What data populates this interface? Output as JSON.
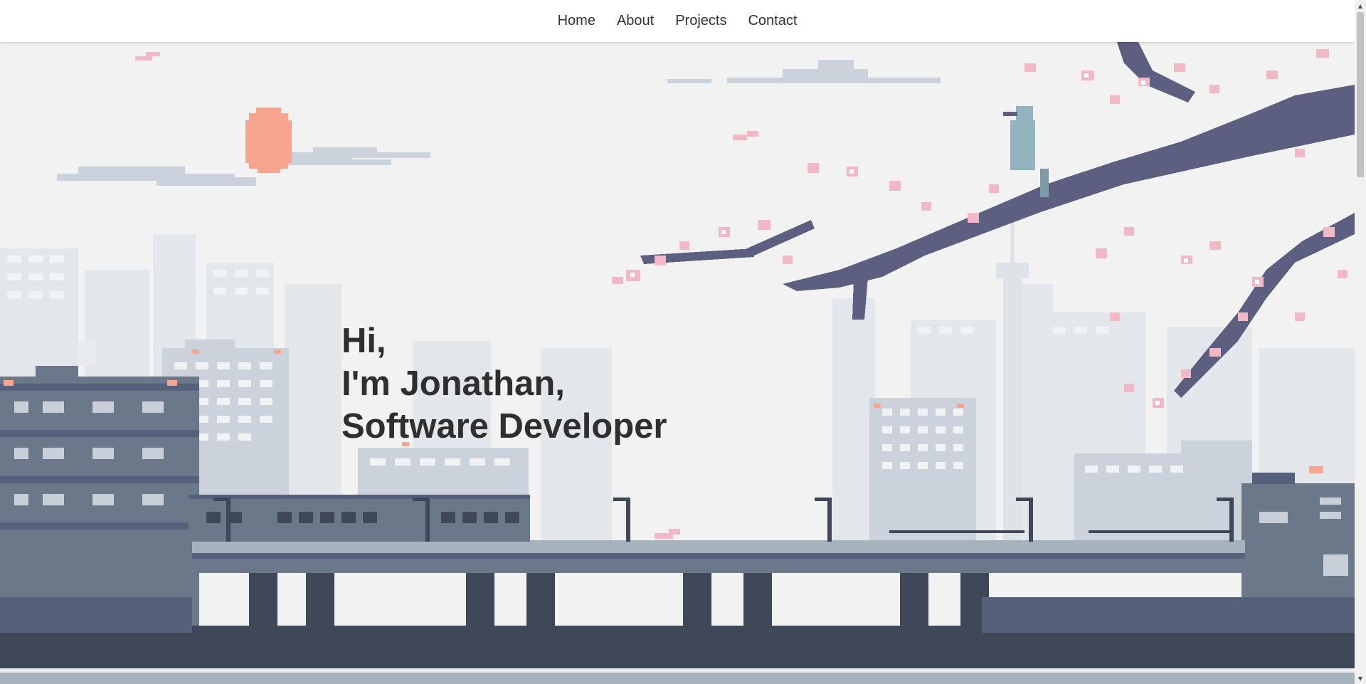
{
  "nav": {
    "items": [
      {
        "label": "Home"
      },
      {
        "label": "About"
      },
      {
        "label": "Projects"
      },
      {
        "label": "Contact"
      }
    ]
  },
  "hero": {
    "line1": "Hi,",
    "line2": "I'm Jonathan,",
    "line3": "Software Developer",
    "background": "pixel-art-city-skyline-with-cherry-blossom-branch-bird-and-elevated-train"
  },
  "colors": {
    "sky": "#f1f2f1",
    "sun": "#f7a58f",
    "heading_text": "#2f2f2f",
    "nav_text": "#333333",
    "blossom": "#f2b8c6",
    "branch": "#5c5f80",
    "bird": "#93b4bf"
  },
  "scrollbar": {
    "up_icon": "triangle-up-icon",
    "down_icon": "triangle-down-icon"
  }
}
